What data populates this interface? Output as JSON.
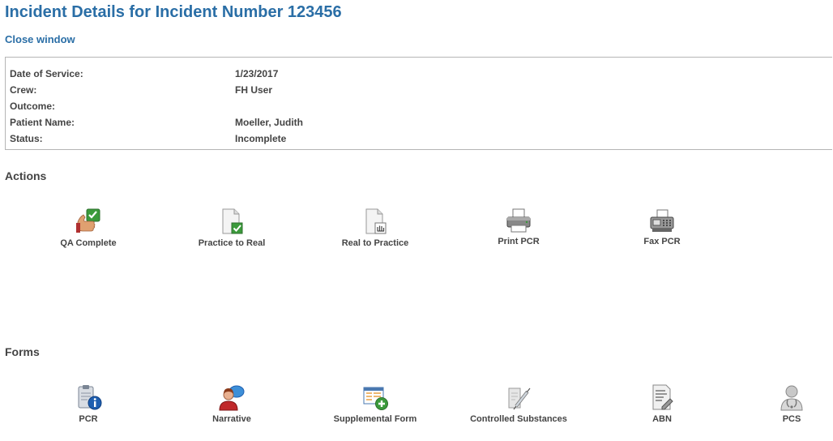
{
  "header": {
    "title": "Incident Details for Incident Number 123456",
    "close_link": "Close window"
  },
  "details": [
    {
      "label": "Date of Service:",
      "value": "1/23/2017"
    },
    {
      "label": "Crew:",
      "value": "FH User"
    },
    {
      "label": "Outcome:",
      "value": ""
    },
    {
      "label": "Patient Name:",
      "value": "Moeller, Judith"
    },
    {
      "label": "Status:",
      "value": "Incomplete"
    }
  ],
  "actions": {
    "title": "Actions",
    "items": [
      {
        "label": "QA Complete",
        "icon": "thumbs-up-check-icon"
      },
      {
        "label": "Practice to Real",
        "icon": "document-check-icon"
      },
      {
        "label": "Real to Practice",
        "icon": "document-hand-icon"
      },
      {
        "label": "Print PCR",
        "icon": "printer-icon"
      },
      {
        "label": "Fax PCR",
        "icon": "fax-icon"
      }
    ]
  },
  "forms": {
    "title": "Forms",
    "items": [
      {
        "label": "PCR",
        "icon": "clipboard-info-icon"
      },
      {
        "label": "Narrative",
        "icon": "person-speech-icon"
      },
      {
        "label": "Supplemental Form",
        "icon": "form-add-icon"
      },
      {
        "label": "Controlled Substances",
        "icon": "syringe-icon"
      },
      {
        "label": "ABN",
        "icon": "document-edit-icon"
      },
      {
        "label": "PCS",
        "icon": "doctor-icon"
      }
    ]
  },
  "colors": {
    "title_blue": "#2a6ea6",
    "label_gray": "#444444",
    "border": "#b5b5b5",
    "check_green": "#3b9a3b"
  }
}
